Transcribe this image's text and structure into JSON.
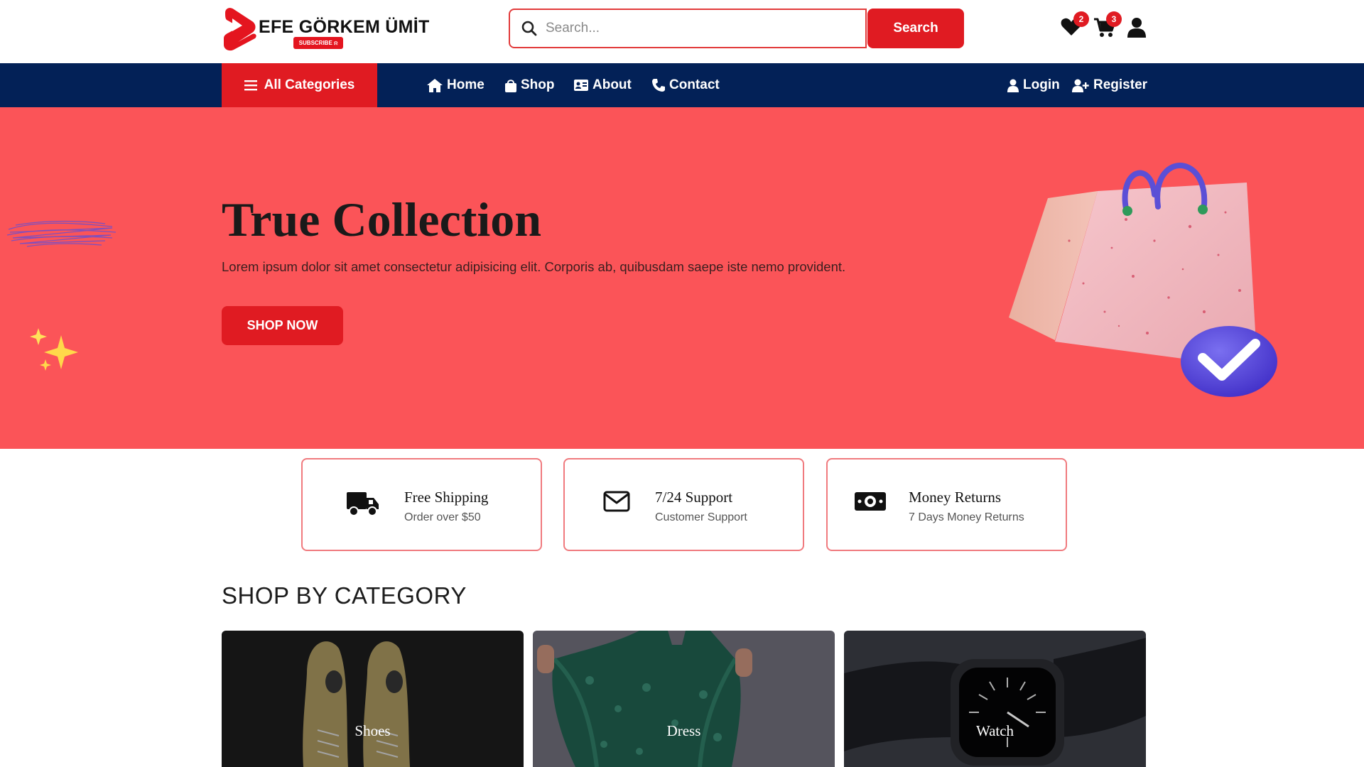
{
  "brand": {
    "name": "EFE GÖRKEM ÜMİT",
    "subscribe_label": "SUBSCRIBE",
    "accent": "#e01b22",
    "navy": "#032157",
    "hero_bg": "#fb5458"
  },
  "search": {
    "placeholder": "Search...",
    "button_label": "Search"
  },
  "header_icons": {
    "wishlist": {
      "icon": "heart-icon",
      "count": "2"
    },
    "cart": {
      "icon": "cart-icon",
      "count": "3"
    },
    "account": {
      "icon": "user-icon"
    }
  },
  "nav": {
    "all_categories": "All Categories",
    "links": [
      {
        "label": "Home",
        "icon": "home-icon"
      },
      {
        "label": "Shop",
        "icon": "shopping-bag-icon"
      },
      {
        "label": "About",
        "icon": "id-card-icon"
      },
      {
        "label": "Contact",
        "icon": "phone-icon"
      }
    ],
    "login": "Login",
    "register": "Register"
  },
  "hero": {
    "title": "True Collection",
    "text": "Lorem ipsum dolor sit amet consectetur adipisicing elit. Corporis ab, quibusdam saepe iste nemo provident.",
    "button_label": "SHOP NOW"
  },
  "features": [
    {
      "title": "Free Shipping",
      "subtitle": "Order over $50",
      "icon": "truck-icon"
    },
    {
      "title": "7/24 Support",
      "subtitle": "Customer Support",
      "icon": "envelope-icon"
    },
    {
      "title": "Money Returns",
      "subtitle": "7 Days Money Returns",
      "icon": "money-icon"
    }
  ],
  "categories": {
    "title": "SHOP BY CATEGORY",
    "items": [
      {
        "label": "Shoes"
      },
      {
        "label": "Dress"
      },
      {
        "label": "Watch"
      }
    ]
  }
}
